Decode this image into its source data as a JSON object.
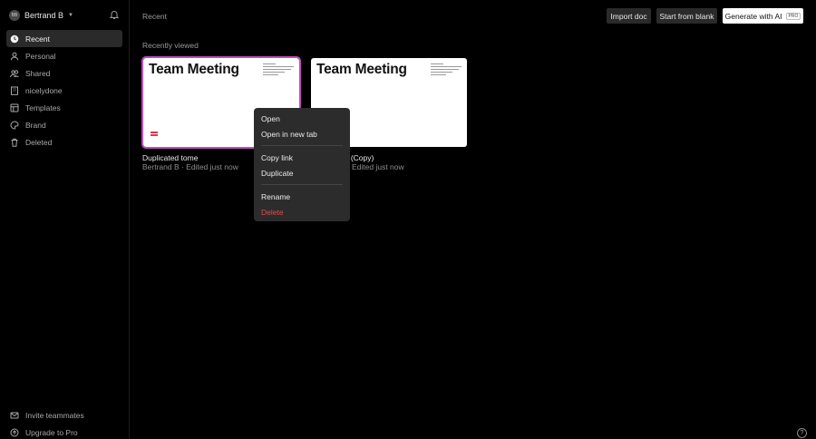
{
  "user": {
    "avatar_initials": "BB",
    "name": "Bertrand B"
  },
  "header": {
    "breadcrumb": "Recent",
    "import_label": "Import doc",
    "blank_label": "Start from blank",
    "ai_label": "Generate with AI",
    "pro_badge": "PRO"
  },
  "sidebar": {
    "items": [
      {
        "label": "Recent",
        "icon": "clock-icon",
        "active": true
      },
      {
        "label": "Personal",
        "icon": "user-icon"
      },
      {
        "label": "Shared",
        "icon": "users-icon"
      },
      {
        "label": "nicelydone",
        "icon": "building-icon"
      },
      {
        "label": "Templates",
        "icon": "template-icon"
      },
      {
        "label": "Brand",
        "icon": "palette-icon"
      },
      {
        "label": "Deleted",
        "icon": "trash-icon"
      }
    ],
    "bottom": [
      {
        "label": "Invite teammates",
        "icon": "mail-icon"
      },
      {
        "label": "Upgrade to Pro",
        "icon": "upgrade-icon"
      }
    ]
  },
  "main": {
    "section_title": "Recently viewed",
    "docs": [
      {
        "thumb_title": "Team Meeting",
        "name": "Duplicated tome",
        "meta": "Bertrand B · Edited just now"
      },
      {
        "thumb_title": "Team Meeting",
        "name": "ng (Copy)",
        "meta": "Edited just now"
      }
    ]
  },
  "context_menu": {
    "items": [
      "Open",
      "Open in new tab",
      "Copy link",
      "Duplicate",
      "Rename",
      "Delete"
    ]
  },
  "help_label": "?"
}
